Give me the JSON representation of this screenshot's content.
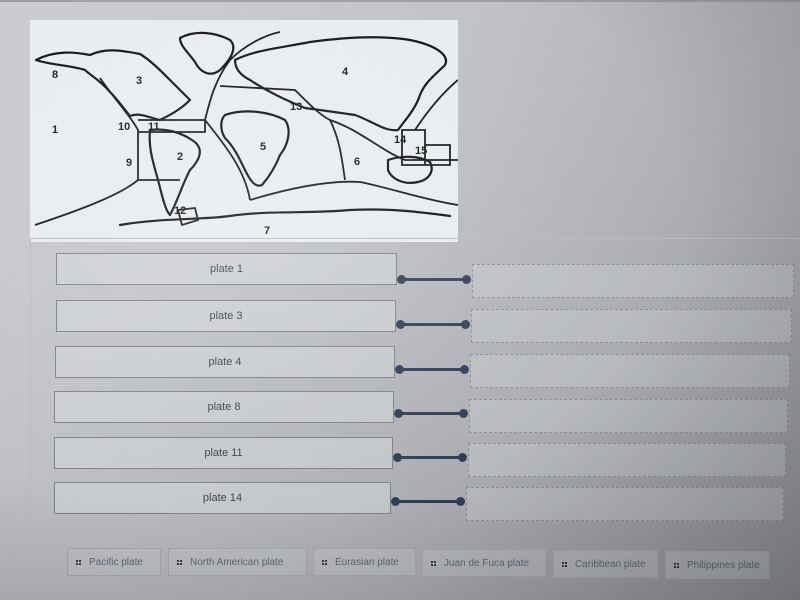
{
  "map": {
    "alt": "World map of tectonic plates with numbered plates",
    "labels": [
      "1",
      "2",
      "3",
      "4",
      "5",
      "6",
      "7",
      "8",
      "9",
      "10",
      "11",
      "12",
      "13",
      "14",
      "15"
    ]
  },
  "matching": {
    "prompts": [
      {
        "label": "plate 1"
      },
      {
        "label": "plate 3"
      },
      {
        "label": "plate 4"
      },
      {
        "label": "plate 8"
      },
      {
        "label": "plate 11"
      },
      {
        "label": "plate 14"
      }
    ],
    "targets": [
      "",
      "",
      "",
      "",
      "",
      ""
    ]
  },
  "answer_bank": [
    {
      "label": "Pacific plate"
    },
    {
      "label": "North American plate"
    },
    {
      "label": "Eurasian plate"
    },
    {
      "label": "Juan de Fuca plate"
    },
    {
      "label": "Caribbean plate"
    },
    {
      "label": "Philippines plate"
    }
  ],
  "colors": {
    "connector": "#2f3e58",
    "prompt_border": "#7f8185",
    "target_border": "#8c8f94"
  }
}
